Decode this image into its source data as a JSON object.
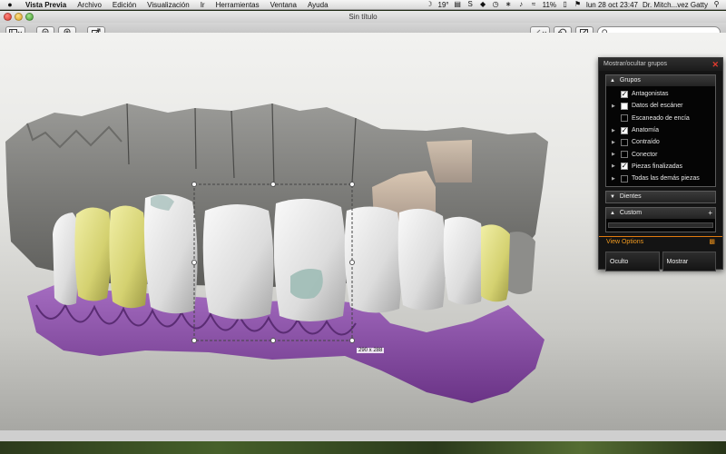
{
  "menubar": {
    "app_name": "Vista Previa",
    "items": [
      "Archivo",
      "Edición",
      "Visualización",
      "Ir",
      "Herramientas",
      "Ventana",
      "Ayuda"
    ],
    "temperature": "19°",
    "battery": "11%",
    "datetime": "lun 28 oct  23:47",
    "user": "Dr. Mitch...vez Gatty"
  },
  "window": {
    "title": "Sin título"
  },
  "viewport": {
    "selection_size": "290 x 288"
  },
  "panel": {
    "title": "Mostrar/ocultar grupos",
    "grupos": {
      "label": "Grupos",
      "items": [
        {
          "label": "Antagonistas",
          "checked": true,
          "expandable": false
        },
        {
          "label": "Datos del escáner",
          "checked": false,
          "expandable": true
        },
        {
          "label": "Escaneado de encía",
          "checked": false,
          "expandable": false
        },
        {
          "label": "Anatomía",
          "checked": true,
          "expandable": true
        },
        {
          "label": "Contraído",
          "checked": false,
          "expandable": true
        },
        {
          "label": "Conector",
          "checked": false,
          "expandable": true
        },
        {
          "label": "Piezas finalizadas",
          "checked": true,
          "expandable": true
        },
        {
          "label": "Todas las demás piezas",
          "checked": false,
          "expandable": true
        }
      ]
    },
    "dientes_label": "Dientes",
    "custom_label": "Custom",
    "view_options_label": "View Options",
    "oculto_label": "Oculto",
    "mostrar_label": "Mostrar"
  },
  "colors": {
    "accent_orange": "#f09a20",
    "close_red": "#e23b2e",
    "tooth_white": "#e6e6e6",
    "tooth_yellow": "#d9d77a",
    "gum_purple": "#8a4ca6",
    "stone_gray": "#8a8a88"
  }
}
